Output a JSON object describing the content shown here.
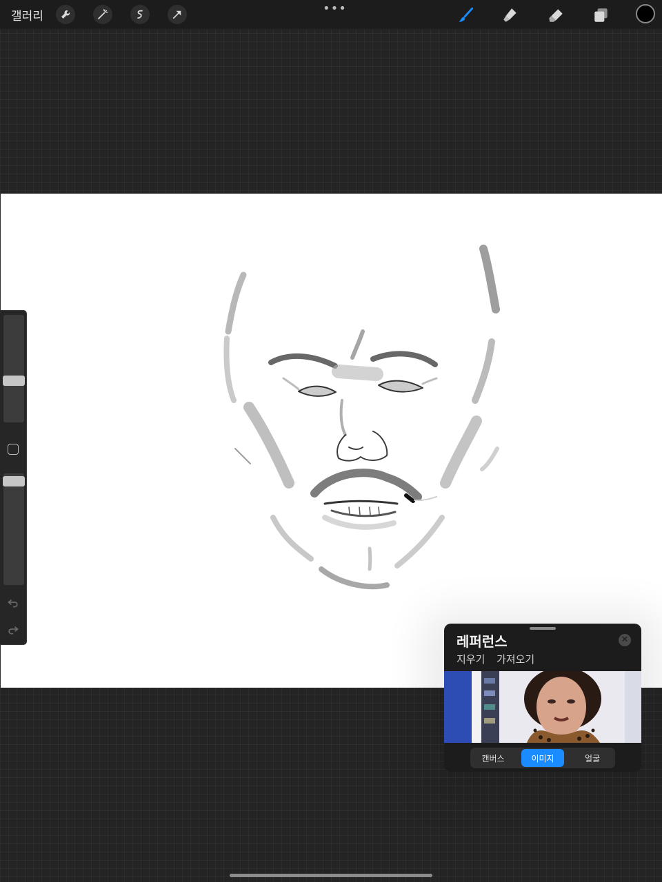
{
  "topbar": {
    "gallery_label": "갤러리",
    "left_tools": [
      "wrench-icon",
      "magic-wand-icon",
      "selection-icon",
      "transform-arrow-icon"
    ],
    "right_tools": [
      "brush-icon",
      "smudge-icon",
      "eraser-icon",
      "layers-icon"
    ],
    "active_tool": "brush-icon",
    "more_label": "•••",
    "current_color": "#000000",
    "accent_color": "#1a8cff"
  },
  "sidebar": {
    "brush_size_level": 0.38,
    "opacity_level": 0.95
  },
  "reference": {
    "title": "레퍼런스",
    "clear_label": "지우기",
    "import_label": "가져오기",
    "close_icon": "close-icon",
    "modes": [
      {
        "label": "캔버스",
        "active": false
      },
      {
        "label": "이미지",
        "active": true
      },
      {
        "label": "얼굴",
        "active": false
      }
    ]
  }
}
